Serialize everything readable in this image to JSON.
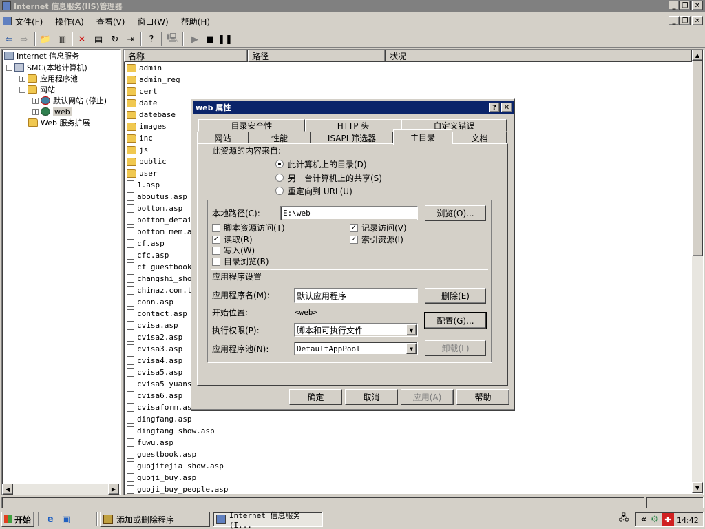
{
  "window": {
    "title": "Internet 信息服务(IIS)管理器"
  },
  "menu": [
    "文件(F)",
    "操作(A)",
    "查看(V)",
    "窗口(W)",
    "帮助(H)"
  ],
  "tree": {
    "root": "Internet 信息服务",
    "server": "SMC(本地计算机)",
    "app_pools": "应用程序池",
    "websites": "网站",
    "default_site": "默认网站 (停止)",
    "web": "web",
    "extensions": "Web 服务扩展"
  },
  "list": {
    "columns": [
      "名称",
      "路径",
      "状况"
    ],
    "folders": [
      "admin",
      "admin_reg",
      "cert",
      "date",
      "datebase",
      "images",
      "inc",
      "js",
      "public",
      "user"
    ],
    "files": [
      "1.asp",
      "aboutus.asp",
      "bottom.asp",
      "bottom_detail",
      "bottom_mem.as",
      "cf.asp",
      "cfc.asp",
      "cf_guestbook.",
      "changshi_show",
      "chinaz.com.tx",
      "conn.asp",
      "contact.asp",
      "cvisa.asp",
      "cvisa2.asp",
      "cvisa3.asp",
      "cvisa4.asp",
      "cvisa5.asp",
      "cvisa5_yuansh",
      "cvisa6.asp",
      "cvisaform.asp",
      "dingfang.asp",
      "dingfang_show.asp",
      "fuwu.asp",
      "guestbook.asp",
      "guojitejia_show.asp",
      "guoji_buy.asp",
      "guoji_buy_people.asp"
    ]
  },
  "dialog": {
    "title": "web 属性",
    "tabs_row1": [
      "目录安全性",
      "HTTP 头",
      "自定义错误"
    ],
    "tabs_row2": [
      "网站",
      "性能",
      "ISAPI 筛选器",
      "主目录",
      "文档"
    ],
    "source_label": "此资源的内容来自:",
    "radio": [
      "此计算机上的目录(D)",
      "另一台计算机上的共享(S)",
      "重定向到 URL(U)"
    ],
    "local_path_label": "本地路径(C):",
    "local_path": "E:\\web",
    "browse": "浏览(O)...",
    "checks_left": [
      {
        "label": "脚本资源访问(T)",
        "checked": false
      },
      {
        "label": "读取(R)",
        "checked": true
      },
      {
        "label": "写入(W)",
        "checked": false
      },
      {
        "label": "目录浏览(B)",
        "checked": false
      }
    ],
    "checks_right": [
      {
        "label": "记录访问(V)",
        "checked": true
      },
      {
        "label": "索引资源(I)",
        "checked": true
      }
    ],
    "app_settings": "应用程序设置",
    "app_name_label": "应用程序名(M):",
    "app_name": "默认应用程序",
    "remove": "删除(E)",
    "start_label": "开始位置:",
    "start_value": "<web>",
    "config": "配置(G)...",
    "exec_label": "执行权限(P):",
    "exec_value": "脚本和可执行文件",
    "pool_label": "应用程序池(N):",
    "pool_value": "DefaultAppPool",
    "unload": "卸载(L)",
    "ok": "确定",
    "cancel": "取消",
    "apply": "应用(A)",
    "help": "帮助"
  },
  "taskbar": {
    "start": "开始",
    "tasks": [
      "添加或删除程序",
      "Internet 信息服务(I..."
    ],
    "clock": "14:42"
  }
}
